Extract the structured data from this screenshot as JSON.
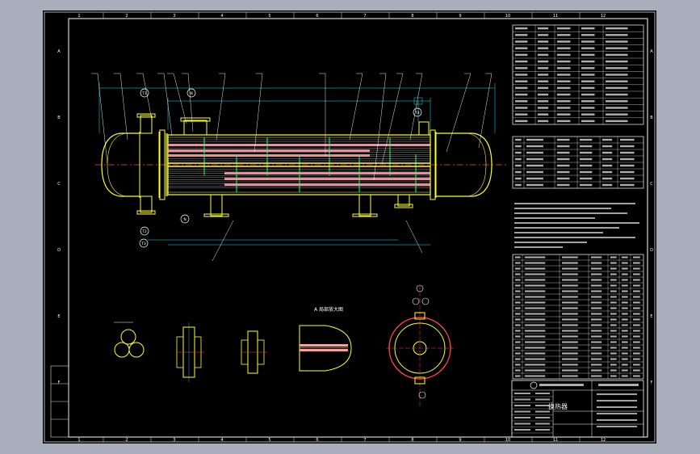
{
  "drawing": {
    "title_block": {
      "drawing_name": "换热器"
    },
    "grid_labels": {
      "top": [
        "1",
        "2",
        "3",
        "4",
        "5",
        "6",
        "7",
        "8",
        "9",
        "10",
        "11",
        "12"
      ],
      "side": [
        "A",
        "B",
        "C",
        "D",
        "E",
        "F"
      ]
    },
    "nozzle_labels": [
      "T1",
      "N",
      "T2",
      "N",
      "T3",
      "T4"
    ],
    "detail_title": "A 局部放大图"
  },
  "colors": {
    "sheet": "#000000",
    "background": "#a9aebd",
    "vessel_outline": "#ffff33",
    "tube_bundle": "#ff9aa8",
    "baffles": "#33ff66",
    "tubes": "#ffffff",
    "centerline": "#ff4444",
    "leaders": "#ffffff",
    "dimension": "#22e0ff"
  }
}
